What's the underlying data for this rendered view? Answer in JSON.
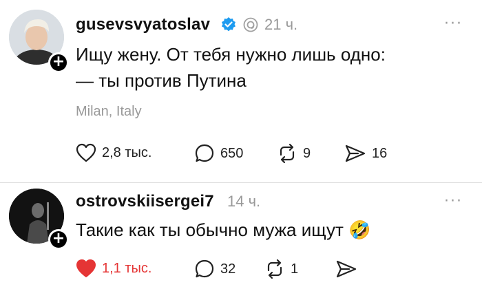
{
  "post": {
    "username": "gusevsvyatoslav",
    "time": "21 ч.",
    "text_line1": "Ищу жену. От тебя нужно лишь одно:",
    "text_line2": "— ты против Путина",
    "location": "Milan, Italy",
    "likes": "2,8 тыс.",
    "comments": "650",
    "reposts": "9",
    "shares": "16",
    "more": "···"
  },
  "reply": {
    "username": "ostrovskiisergei7",
    "time": "14 ч.",
    "text": "Такие как ты обычно мужа ищут",
    "emoji": "🤣",
    "likes": "1,1 тыс.",
    "comments": "32",
    "reposts": "1",
    "more": "···"
  },
  "colors": {
    "liked": "#e53535",
    "verified": "#1d9bf0"
  },
  "icons": [
    "verified-badge-icon",
    "threads-icon",
    "heart-icon",
    "comment-icon",
    "repost-icon",
    "share-icon",
    "plus-icon",
    "more-icon"
  ]
}
